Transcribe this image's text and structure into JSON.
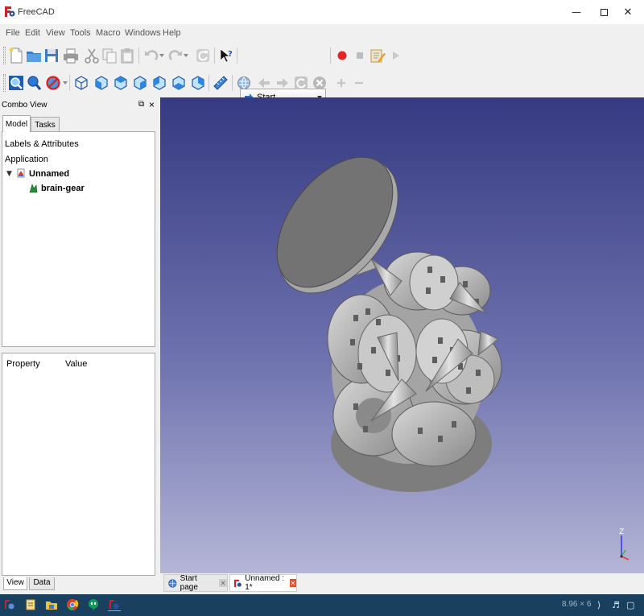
{
  "window": {
    "title": "FreeCAD"
  },
  "menu": [
    "File",
    "Edit",
    "View",
    "Tools",
    "Macro",
    "Windows",
    "Help"
  ],
  "toolbar1": {
    "icons": [
      "new-file-icon",
      "open-folder-icon",
      "save-icon",
      "print-icon",
      "cut-icon",
      "copy-icon",
      "paste-icon",
      "undo-icon",
      "redo-icon",
      "refresh-icon",
      "whats-this-icon",
      "record-macro-icon",
      "stop-macro-icon",
      "edit-macro-icon",
      "run-macro-icon"
    ],
    "workbench": "Start"
  },
  "toolbar2": {
    "icons": [
      "fit-all-icon",
      "fit-selection-icon",
      "draw-style-icon",
      "view-isometric-icon",
      "view-front-icon",
      "view-top-icon",
      "view-right-icon",
      "view-rear-icon",
      "view-bottom-icon",
      "view-left-icon",
      "measure-icon",
      "web-home-icon",
      "nav-back-icon",
      "nav-forward-icon",
      "nav-refresh-icon",
      "nav-stop-icon",
      "zoom-in-icon",
      "zoom-out-icon"
    ]
  },
  "combo": {
    "title": "Combo View",
    "float_symbol": "⧉",
    "close_symbol": "×",
    "tabs": [
      "Model",
      "Tasks"
    ],
    "tree": {
      "section": "Labels & Attributes",
      "group": "Application",
      "document": "Unnamed",
      "object": "brain-gear"
    },
    "property": {
      "col1": "Property",
      "col2": "Value"
    },
    "bottom_tabs": [
      "View",
      "Data"
    ]
  },
  "view3d": {
    "axis_label": "Z",
    "background_top": "#353a82",
    "background_bottom": "#b4b5d6"
  },
  "doc_tabs": [
    {
      "label": "Start page",
      "active": false
    },
    {
      "label": "Unnamed : 1*",
      "active": true
    }
  ],
  "taskbar": {
    "tray_text": "8.96 × 6",
    "icons": [
      "freecad-icon",
      "notepad-icon",
      "folder-icon",
      "chrome-icon",
      "hangouts-icon",
      "freecad-running-icon"
    ],
    "tray_icons": [
      "network-icon",
      "volume-icon",
      "notification-icon"
    ]
  }
}
